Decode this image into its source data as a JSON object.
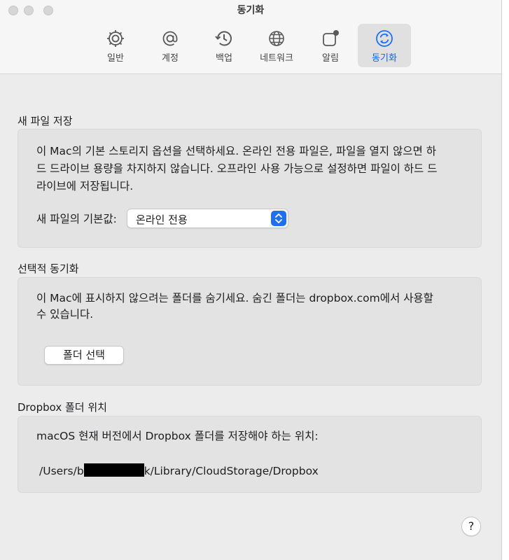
{
  "window": {
    "title": "동기화"
  },
  "tabs": [
    {
      "label": "일반",
      "icon": "gear-icon"
    },
    {
      "label": "계정",
      "icon": "at-sign-icon"
    },
    {
      "label": "백업",
      "icon": "history-clock-icon"
    },
    {
      "label": "네트워크",
      "icon": "globe-icon"
    },
    {
      "label": "알림",
      "icon": "notification-badge-icon"
    },
    {
      "label": "동기화",
      "icon": "sync-icon",
      "active": true
    }
  ],
  "new_file": {
    "title": "새 파일 저장",
    "line1": "이 Mac의 기본 스토리지 옵션을 선택하세요. 온라인 전용 파일은, 파일을 열지 않으면 하",
    "line2": "드 드라이브 용량을 차지하지 않습니다. 오프라인 사용 가능으로 설정하면 파일이 하드 드",
    "line3": "라이브에 저장됩니다.",
    "default_label": "새 파일의 기본값:",
    "default_value": "온라인 전용"
  },
  "selective_sync": {
    "title": "선택적 동기화",
    "line1": "이 Mac에 표시하지 않으려는 폴더를 숨기세요. 숨긴 폴더는 dropbox.com에서 사용할",
    "line2": "수 있습니다.",
    "button_label": "폴더 선택"
  },
  "location": {
    "title": "Dropbox 폴더 위치",
    "description": "macOS 현재 버전에서 Dropbox 폴더를 저장해야 하는 위치:",
    "path_prefix": "/Users/b",
    "path_suffix": "k/Library/CloudStorage/Dropbox"
  },
  "help": {
    "label": "?"
  },
  "colors": {
    "accent": "#1f6ff0",
    "active_tab_text": "#0a64d8"
  }
}
